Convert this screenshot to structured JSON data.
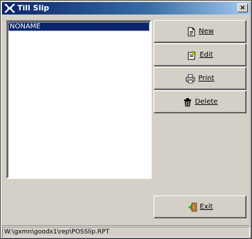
{
  "window": {
    "title": "Till Slip",
    "close_label": "×"
  },
  "list": {
    "items": [
      "NONAME"
    ],
    "selected_index": 0
  },
  "buttons": {
    "new": {
      "label": "New",
      "icon": "new-document-icon"
    },
    "edit": {
      "label": "Edit",
      "icon": "edit-document-icon"
    },
    "print": {
      "label": "Print",
      "icon": "printer-icon"
    },
    "delete": {
      "label": "Delete",
      "icon": "trash-icon"
    },
    "exit": {
      "label": "Exit",
      "icon": "exit-door-icon"
    }
  },
  "status": {
    "path": "W:\\gxmn\\goodx1\\rep\\POSSlip.RPT"
  },
  "colors": {
    "title_start": "#0a246a",
    "title_end": "#a6caf0",
    "selection": "#0a246a",
    "face": "#d4d0c8"
  }
}
